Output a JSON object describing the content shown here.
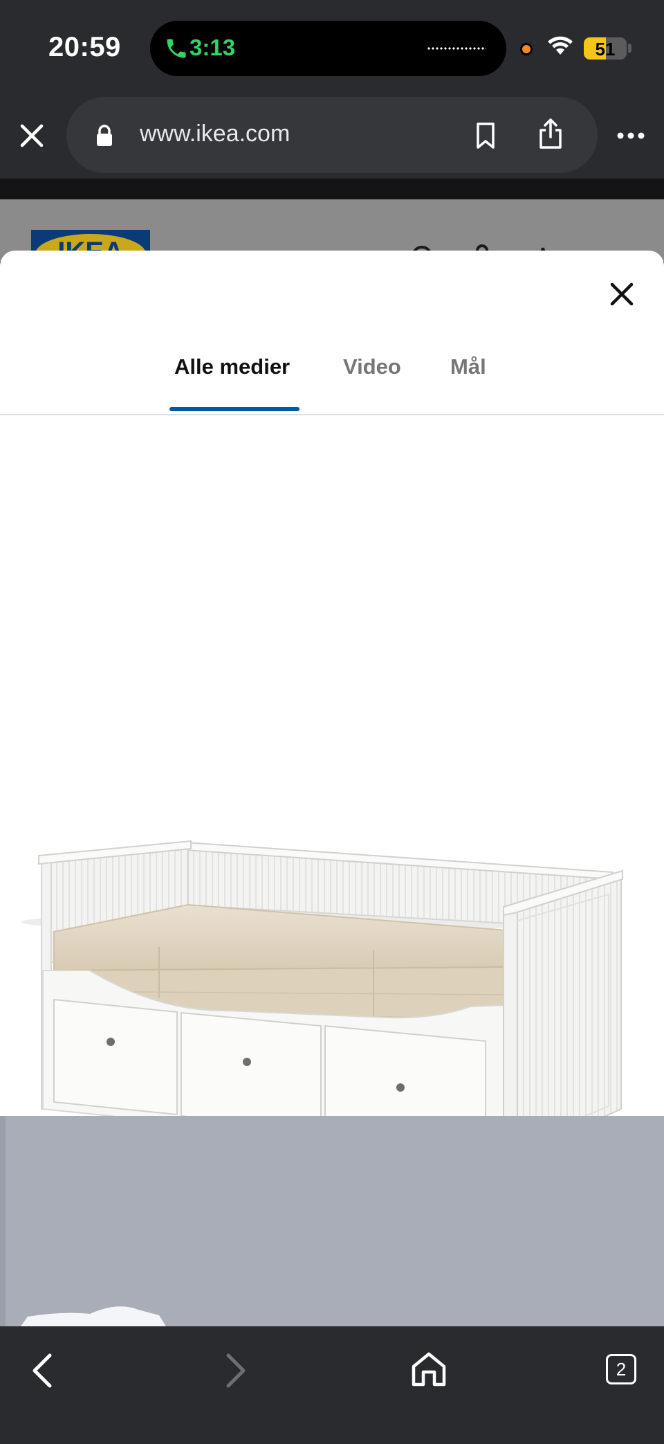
{
  "status_bar": {
    "time": "20:59",
    "call_time": "3:13",
    "battery_percent": "51",
    "battery_level": 0.51,
    "icons": [
      "phone-call-icon",
      "audio-activity-icon",
      "recording-dot-icon",
      "wifi-icon",
      "battery-icon"
    ]
  },
  "browser": {
    "url": "www.ikea.com",
    "secure": true,
    "tab_count": "2",
    "icons": [
      "close-icon",
      "lock-icon",
      "bookmark-icon",
      "share-icon",
      "more-icon",
      "back-icon",
      "forward-icon",
      "home-icon",
      "tabs-icon"
    ]
  },
  "page_behind": {
    "logo_text": "IKEA",
    "icons": [
      "search-icon",
      "account-icon",
      "favourites-icon",
      "menu-icon"
    ]
  },
  "media_viewer": {
    "tabs": [
      {
        "label": "Alle medier",
        "active": true
      },
      {
        "label": "Video",
        "active": false
      },
      {
        "label": "Mål",
        "active": false
      }
    ],
    "close_icon": "close-icon"
  },
  "colors": {
    "browser_chrome": "#2a2b2f",
    "tab_active_underline": "#0058a3",
    "ikea_blue": "#0b3a78",
    "ikea_yellow": "#c9a91a",
    "call_green": "#33d463"
  }
}
